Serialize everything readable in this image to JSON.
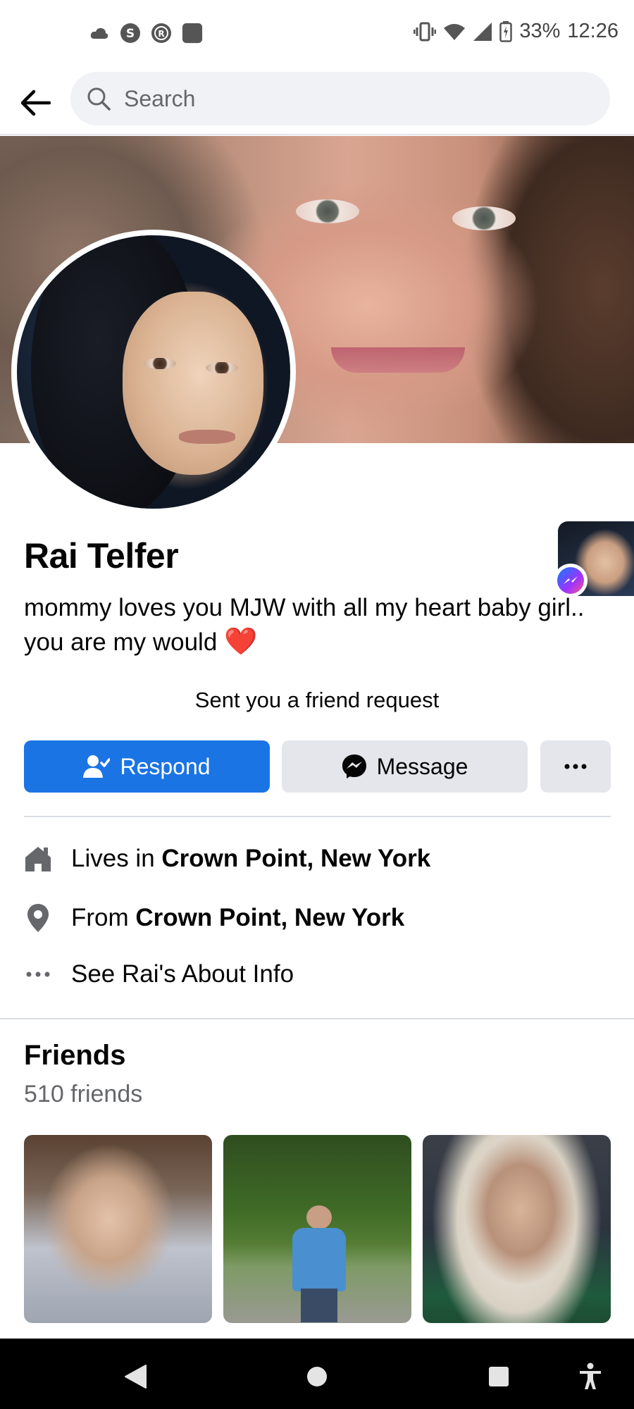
{
  "status_bar": {
    "battery": "33%",
    "time": "12:26"
  },
  "header": {
    "search_placeholder": "Search"
  },
  "profile": {
    "name": "Rai Telfer",
    "bio_text": "mommy loves you MJW with all my heart baby girl.. you are my would",
    "bio_emoji": "❤️"
  },
  "friend_request": {
    "note": "Sent you a friend request"
  },
  "actions": {
    "respond_label": "Respond",
    "message_label": "Message",
    "more_label": "···"
  },
  "about": {
    "lives_in_prefix": "Lives in",
    "lives_in_place": "Crown Point, New York",
    "from_prefix": "From",
    "from_place": "Crown Point, New York",
    "see_about": "See Rai's About Info"
  },
  "friends": {
    "title": "Friends",
    "count": "510 friends"
  },
  "colors": {
    "primary": "#1b74e4",
    "secondary_button": "#e4e6eb",
    "secondary_text": "#65676b",
    "heart": "#e0202c"
  },
  "icons": {
    "status_left": [
      "cloud-icon",
      "s-app-icon",
      "r-app-icon",
      "square-app-icon"
    ],
    "status_right": [
      "vibrate-icon",
      "wifi-icon",
      "signal-icon",
      "battery-icon"
    ],
    "nav": [
      "nav-back-icon",
      "nav-home-icon",
      "nav-recents-icon",
      "accessibility-icon"
    ]
  }
}
